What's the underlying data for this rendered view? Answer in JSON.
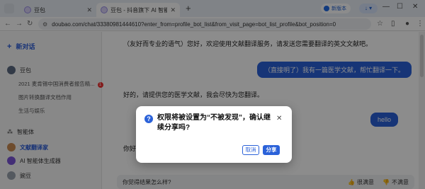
{
  "browser": {
    "tabs": [
      {
        "title": "豆包"
      },
      {
        "title": "豆包 - 抖音旗下 AI 智能助手"
      }
    ],
    "new_version_label": "新版本",
    "url": "doubao.com/chat/33380981444610?enter_from=profile_bot_list&from_visit_page=bot_list_profile&bot_position=0"
  },
  "sidebar": {
    "new_chat_label": "新对话",
    "assistant_name": "豆包",
    "history": [
      {
        "label": "2021 麦肯锡中国消费者报告精..."
      },
      {
        "label": "图片转换翻译文档作用"
      },
      {
        "label": "生活与娱乐"
      }
    ],
    "history_badge": "1",
    "agents_label": "智能体",
    "agents": [
      {
        "label": "文献翻译家"
      },
      {
        "label": "AI 智能体生成器"
      },
      {
        "label": "豌豆"
      }
    ]
  },
  "chat": {
    "messages": [
      {
        "role": "bot",
        "text": "（友好而专业的语气）您好，欢迎使用文献翻译服务，请发送您需要翻译的英文文献吧。"
      },
      {
        "role": "user",
        "text": "（直接明了）我有一篇医学文献，帮忙翻译一下。"
      },
      {
        "role": "bot",
        "text": "好的，请提供您的医学文献，我会尽快为您翻译。"
      },
      {
        "role": "user",
        "text": "hello"
      },
      {
        "role": "bot",
        "text": "你好，"
      }
    ],
    "feedback": {
      "question": "你觉得结果怎么样?",
      "good_label": "很满意",
      "bad_label": "不满意"
    }
  },
  "modal": {
    "title": "权限将被设置为“不被发现”，确认继续分享吗?",
    "cancel_label": "取消",
    "share_label": "分享"
  },
  "colors": {
    "accent": "#2b62d9",
    "overlay": "rgba(0,0,0,0.45)"
  }
}
